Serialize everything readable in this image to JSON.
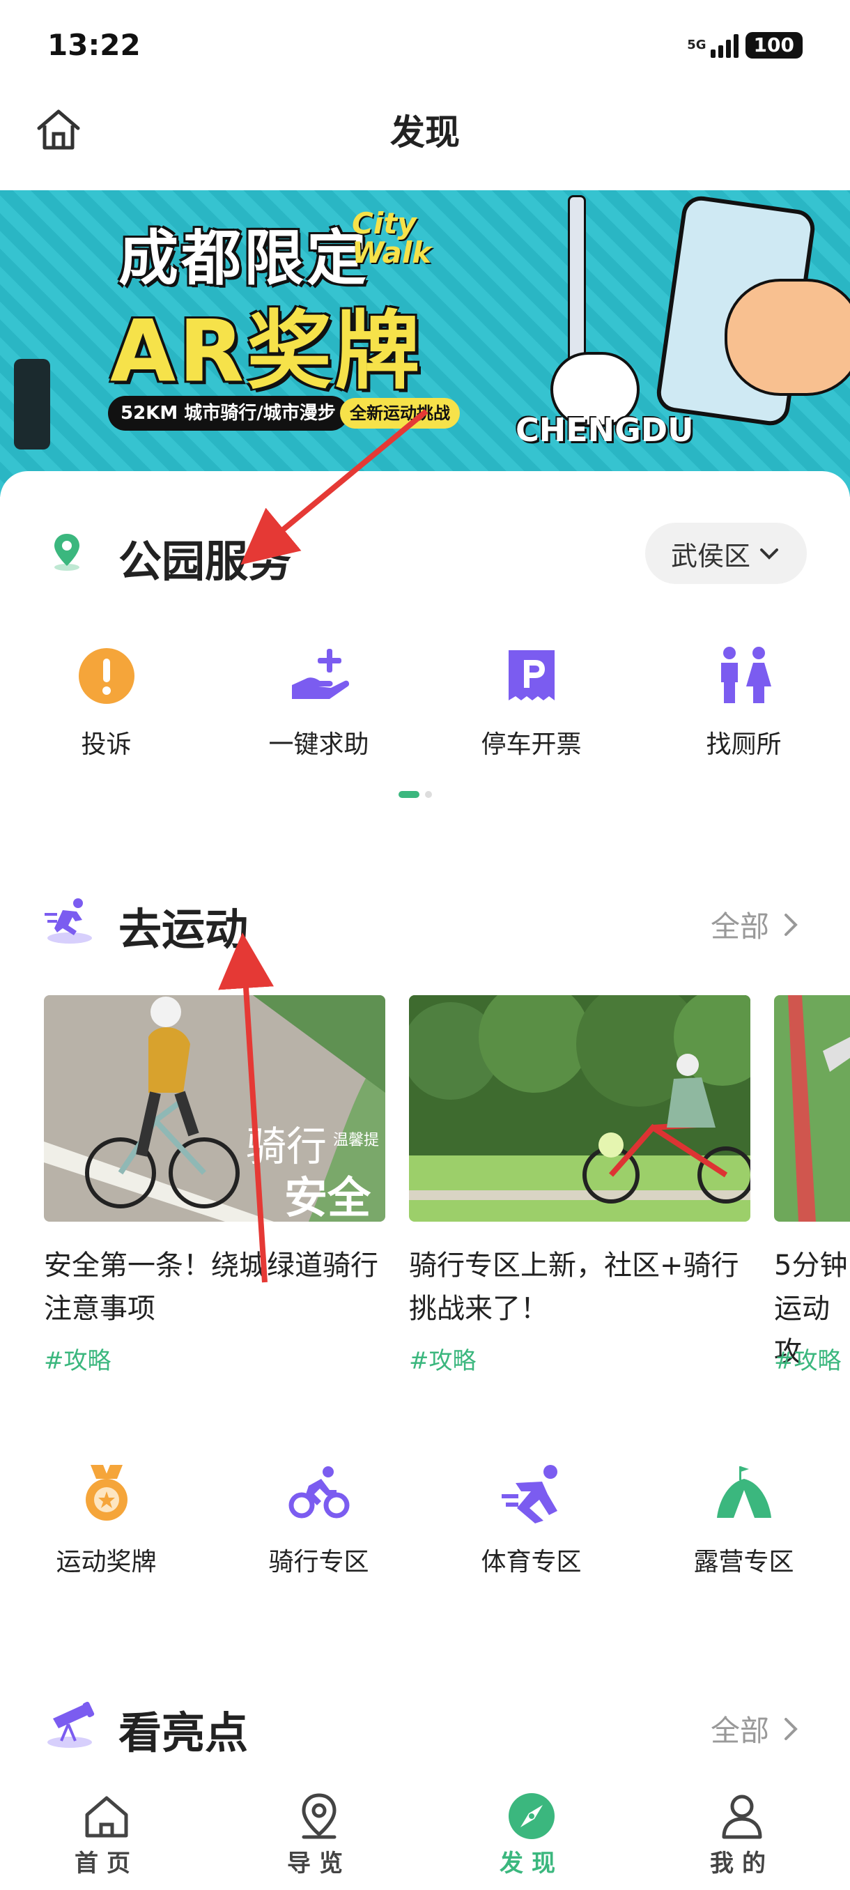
{
  "status": {
    "time": "13:22",
    "network": "5G",
    "battery": "100"
  },
  "header": {
    "title": "发现"
  },
  "banner": {
    "title_line1": "成都限定",
    "city_walk": "City Walk",
    "title_line2": "AR奖牌",
    "subtitle": "52KM 城市骑行/城市漫步",
    "tag": "全新运动挑战",
    "chengdu": "CHENGDU"
  },
  "park_service": {
    "title": "公园服务",
    "district": "武侯区",
    "items": [
      {
        "label": "投诉",
        "icon": "exclamation-icon",
        "color": "#f5a53a"
      },
      {
        "label": "一键求助",
        "icon": "help-hand-icon",
        "color": "#7b5cf0"
      },
      {
        "label": "停车开票",
        "icon": "parking-ticket-icon",
        "color": "#7b5cf0"
      },
      {
        "label": "找厕所",
        "icon": "toilet-icon",
        "color": "#7b5cf0"
      }
    ]
  },
  "sport": {
    "title": "去运动",
    "more": "全部",
    "articles": [
      {
        "title": "安全第一条！绕城绿道骑行注意事项",
        "tag": "#攻略",
        "overlay1": "骑行",
        "overlay2": "安全",
        "overlay_small": "温馨提"
      },
      {
        "title": "骑行专区上新，社区+骑行挑战来了！",
        "tag": "#攻略"
      },
      {
        "title": "5分钟运动攻",
        "tag": "#攻略"
      }
    ],
    "zones": [
      {
        "label": "运动奖牌",
        "icon": "medal-icon"
      },
      {
        "label": "骑行专区",
        "icon": "cycling-icon"
      },
      {
        "label": "体育专区",
        "icon": "running-icon"
      },
      {
        "label": "露营专区",
        "icon": "tent-icon"
      }
    ]
  },
  "highlights": {
    "title": "看亮点",
    "more": "全部"
  },
  "tabbar": {
    "tabs": [
      {
        "label": "首页",
        "icon": "home-icon"
      },
      {
        "label": "导览",
        "icon": "map-pin-icon"
      },
      {
        "label": "发现",
        "icon": "compass-icon",
        "active": true
      },
      {
        "label": "我的",
        "icon": "user-icon"
      }
    ]
  },
  "colors": {
    "accent_green": "#3bb77e",
    "accent_purple": "#7b5cf0",
    "orange": "#f5a53a"
  }
}
